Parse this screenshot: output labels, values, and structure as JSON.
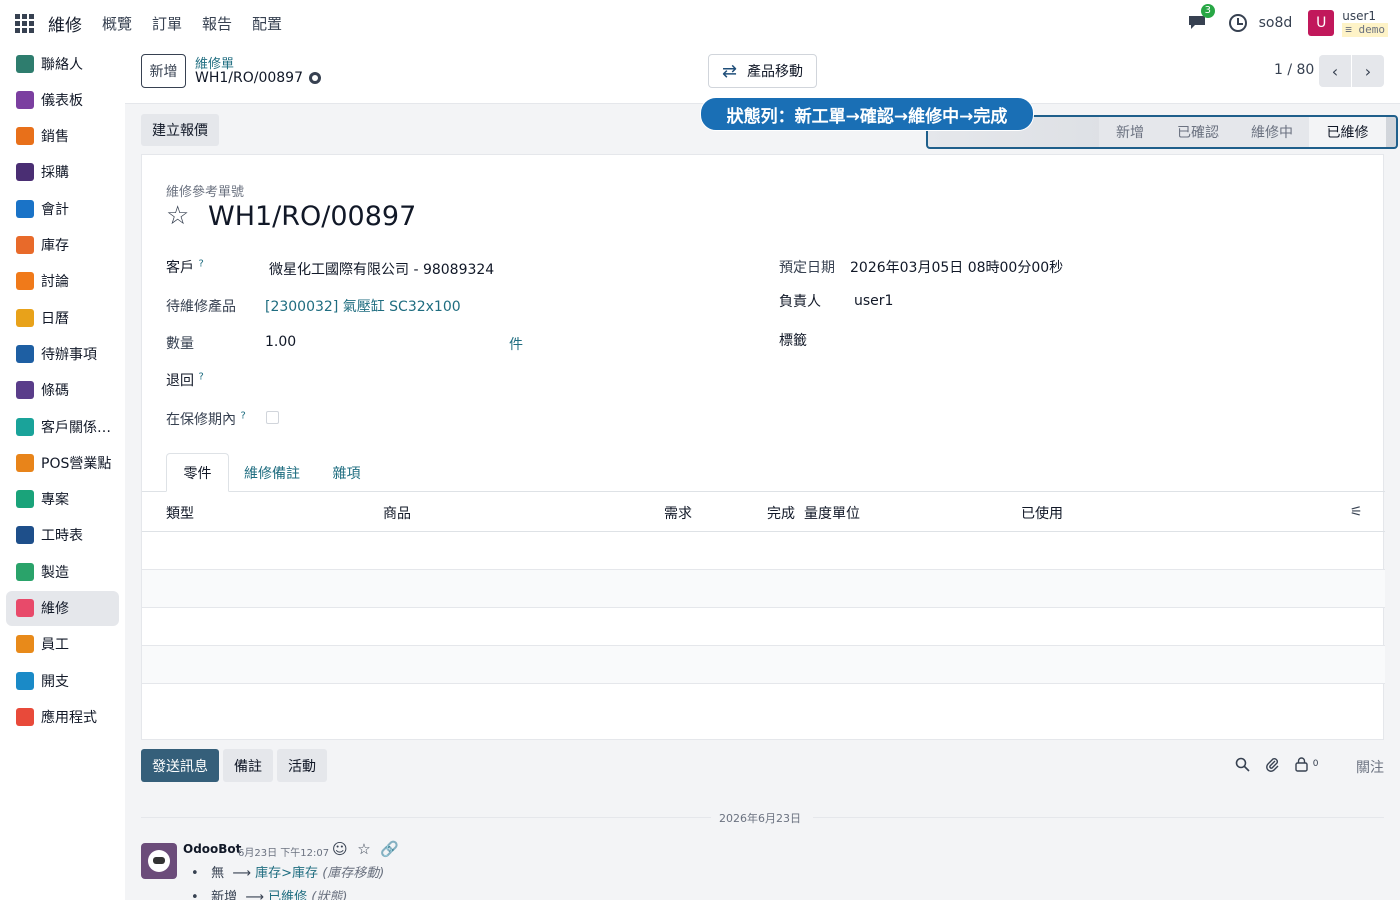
{
  "topbar": {
    "app_title": "維修",
    "menu": [
      "概覽",
      "訂單",
      "報告",
      "配置"
    ],
    "chat_badge": "3",
    "db": "so8d",
    "avatar_letter": "U",
    "username": "user1",
    "demo_tag": "demo"
  },
  "sidebar": {
    "items": [
      {
        "label": "聯絡人",
        "icon": "contacts-icon",
        "color": "#2e7d6e"
      },
      {
        "label": "儀表板",
        "icon": "dashboard-icon",
        "color": "#7b3fa0"
      },
      {
        "label": "銷售",
        "icon": "sales-icon",
        "color": "#e8701a"
      },
      {
        "label": "採購",
        "icon": "purchase-icon",
        "color": "#4a2e73"
      },
      {
        "label": "會計",
        "icon": "accounting-icon",
        "color": "#1a73c7"
      },
      {
        "label": "庫存",
        "icon": "inventory-icon",
        "color": "#e86a2a"
      },
      {
        "label": "討論",
        "icon": "discuss-icon",
        "color": "#f07a1a"
      },
      {
        "label": "日曆",
        "icon": "calendar-icon",
        "color": "#e8a21a"
      },
      {
        "label": "待辦事項",
        "icon": "todo-icon",
        "color": "#1e5fa3"
      },
      {
        "label": "條碼",
        "icon": "barcode-icon",
        "color": "#5a3d8a"
      },
      {
        "label": "客戶關係管理",
        "icon": "crm-icon",
        "color": "#1aa39a"
      },
      {
        "label": "POS營業點",
        "icon": "pos-icon",
        "color": "#e8841a"
      },
      {
        "label": "專案",
        "icon": "project-icon",
        "color": "#1aa37a"
      },
      {
        "label": "工時表",
        "icon": "timesheet-icon",
        "color": "#1e4f8a"
      },
      {
        "label": "製造",
        "icon": "manufacturing-icon",
        "color": "#2aa36a"
      },
      {
        "label": "維修",
        "icon": "repair-icon",
        "color": "#e84a6a",
        "active": true
      },
      {
        "label": "員工",
        "icon": "employees-icon",
        "color": "#e88a1a"
      },
      {
        "label": "開支",
        "icon": "expenses-icon",
        "color": "#1a8ac7"
      },
      {
        "label": "應用程式",
        "icon": "apps-icon",
        "color": "#e84a3a"
      }
    ]
  },
  "control": {
    "new_label": "新增",
    "bc_parent": "維修單",
    "bc_current": "WH1/RO/00897",
    "move_label": "產品移動",
    "pager": "1 / 80"
  },
  "status": {
    "quote_label": "建立報價",
    "steps": [
      "新增",
      "已確認",
      "維修中",
      "已維修"
    ],
    "current": "已維修",
    "callout": "狀態列：新工單→確認→維修中→完成"
  },
  "form": {
    "ref_label": "維修參考單號",
    "title": "WH1/RO/00897",
    "customer_label": "客戶",
    "customer_value": "微星化工國際有限公司 - 98089324",
    "product_label": "待維修產品",
    "product_value": "[2300032] 氣壓缸 SC32x100",
    "qty_label": "數量",
    "qty_value": "1.00",
    "uom": "件",
    "return_label": "退回",
    "warranty_label": "在保修期內",
    "q": "?",
    "date_label": "預定日期",
    "date_value": "2026年03月05日 08時00分00秒",
    "resp_label": "負責人",
    "resp_value": "user1",
    "tags_label": "標籤"
  },
  "tabs": [
    "零件",
    "維修備註",
    "雜項"
  ],
  "table": {
    "headers": [
      "類型",
      "商品",
      "需求",
      "完成",
      "量度單位",
      "已使用"
    ]
  },
  "chatter": {
    "send_label": "發送訊息",
    "note_label": "備註",
    "activity_label": "活動",
    "followers_count": "0",
    "follow_label": "關注",
    "date_sep": "2026年6月23日",
    "author": "OdooBot",
    "time": "6月23日 下午12:07",
    "tracking": [
      {
        "old": "無",
        "new": "庫存>庫存",
        "field": "(庫存移動)"
      },
      {
        "old": "新增",
        "new": "已維修",
        "field": "(狀態)"
      }
    ]
  }
}
